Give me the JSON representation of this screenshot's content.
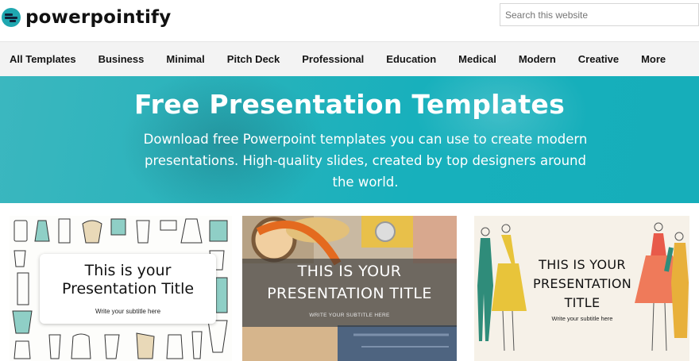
{
  "header": {
    "logo_text": "powerpointify",
    "search_placeholder": "Search this website"
  },
  "nav": {
    "items": [
      {
        "label": "All Templates"
      },
      {
        "label": "Business"
      },
      {
        "label": "Minimal"
      },
      {
        "label": "Pitch Deck"
      },
      {
        "label": "Professional"
      },
      {
        "label": "Education"
      },
      {
        "label": "Medical"
      },
      {
        "label": "Modern"
      },
      {
        "label": "Creative"
      },
      {
        "label": "More"
      }
    ]
  },
  "hero": {
    "title": "Free Presentation Templates",
    "subtitle": "Download free Powerpoint templates you can use to create modern presentations. High-quality slides, created by top designers around the world.",
    "color": "#1fb0bb"
  },
  "cards": [
    {
      "title_line1": "This is your",
      "title_line2": "Presentation Title",
      "subtitle": "Write your subtitle here"
    },
    {
      "title_line1": "THIS IS YOUR",
      "title_line2": "PRESENTATION TITLE",
      "subtitle": "WRITE YOUR SUBTITLE HERE"
    },
    {
      "title_line1": "THIS IS YOUR",
      "title_line2": "PRESENTATION",
      "title_line3": "TITLE",
      "subtitle": "Write your subtitle here"
    }
  ],
  "icons": {
    "logo": "presentation-logo-icon"
  }
}
